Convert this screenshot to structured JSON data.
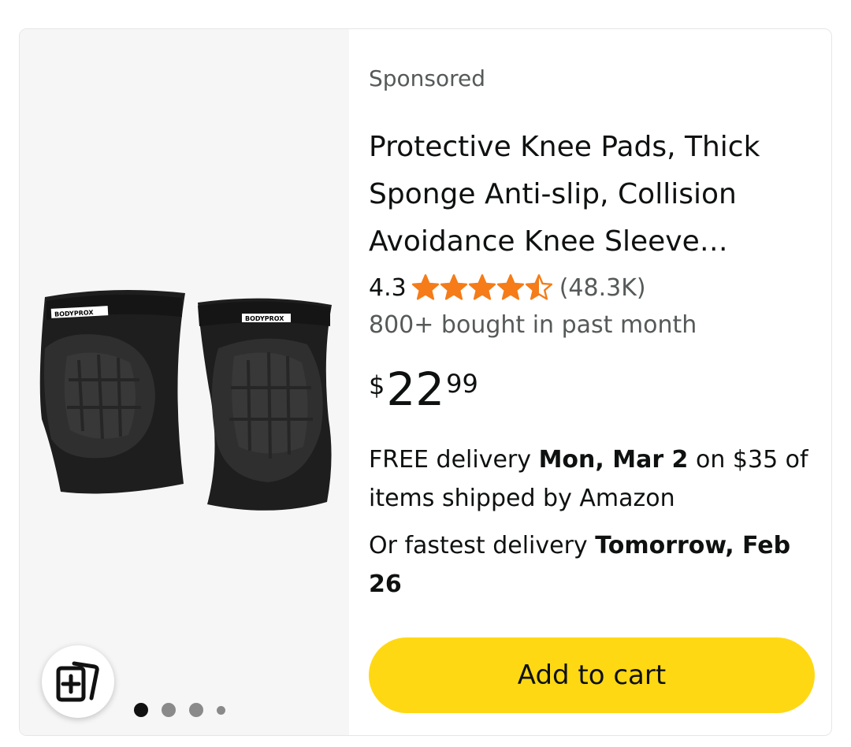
{
  "colors": {
    "star": "#f57c18",
    "button": "#ffd814",
    "muted_text": "#565959",
    "image_background": "#f6f6f6"
  },
  "product": {
    "sponsored_label": "Sponsored",
    "title": "Protective Knee Pads, Thick Sponge Anti-slip, Collision Avoidance Knee Sleeve…",
    "image_brand_text": "BODYPROX",
    "rating_value": "4.3",
    "rating_stars": 4.5,
    "rating_count": "(48.3K)",
    "bought_text": "800+ bought in past month",
    "price": {
      "symbol": "$",
      "whole": "22",
      "fraction": "99"
    },
    "delivery": {
      "prefix": "FREE delivery",
      "date": "Mon, Mar 2",
      "suffix": "on $35 of items shipped by Amazon"
    },
    "fastest": {
      "prefix": "Or fastest delivery",
      "date": "Tomorrow, Feb 26"
    },
    "add_to_cart_label": "Add to cart"
  },
  "carousel": {
    "total_dots": 4,
    "active_index": 0
  },
  "icons": {
    "compare": "add-to-compare-icon",
    "star": "star-icon"
  }
}
